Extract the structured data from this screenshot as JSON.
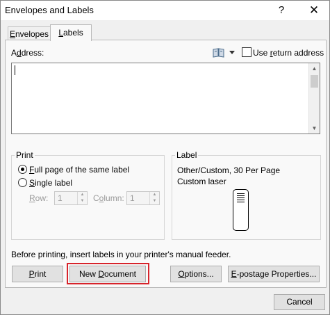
{
  "window": {
    "title": "Envelopes and Labels",
    "help_glyph": "?",
    "close_glyph": "✕"
  },
  "tabs": [
    {
      "pre": "",
      "ul": "E",
      "post": "nvelopes"
    },
    {
      "pre": "",
      "ul": "L",
      "post": "abels"
    }
  ],
  "address": {
    "label": {
      "pre": "A",
      "ul": "d",
      "post": "dress:"
    },
    "value": "",
    "address_book_icon": "address-book-icon",
    "use_return": {
      "pre": "Use ",
      "ul": "r",
      "post": "eturn address",
      "checked": false
    }
  },
  "print_group": {
    "title": "Print",
    "full_page": {
      "pre": "",
      "ul": "F",
      "post": "ull page of the same label",
      "selected": true
    },
    "single": {
      "pre": "",
      "ul": "S",
      "post": "ingle label",
      "selected": false
    },
    "row": {
      "pre": "",
      "ul": "R",
      "post": "ow:",
      "value": "1"
    },
    "column": {
      "pre": "C",
      "ul": "o",
      "post": "lumn:",
      "value": "1"
    }
  },
  "label_group": {
    "title": "Label",
    "line1": "Other/Custom, 30 Per Page",
    "line2": "Custom laser"
  },
  "info_text": "Before printing, insert labels in your printer's manual feeder.",
  "buttons": {
    "print": {
      "pre": "",
      "ul": "P",
      "post": "rint"
    },
    "new_document": {
      "pre": "New ",
      "ul": "D",
      "post": "ocument"
    },
    "options": {
      "pre": "",
      "ul": "O",
      "post": "ptions..."
    },
    "epostage": {
      "pre": "",
      "ul": "E",
      "post": "-postage Properties..."
    },
    "cancel": "Cancel"
  },
  "colors": {
    "highlight": "#d7232b",
    "dialog_bg": "#f0f0f0"
  }
}
